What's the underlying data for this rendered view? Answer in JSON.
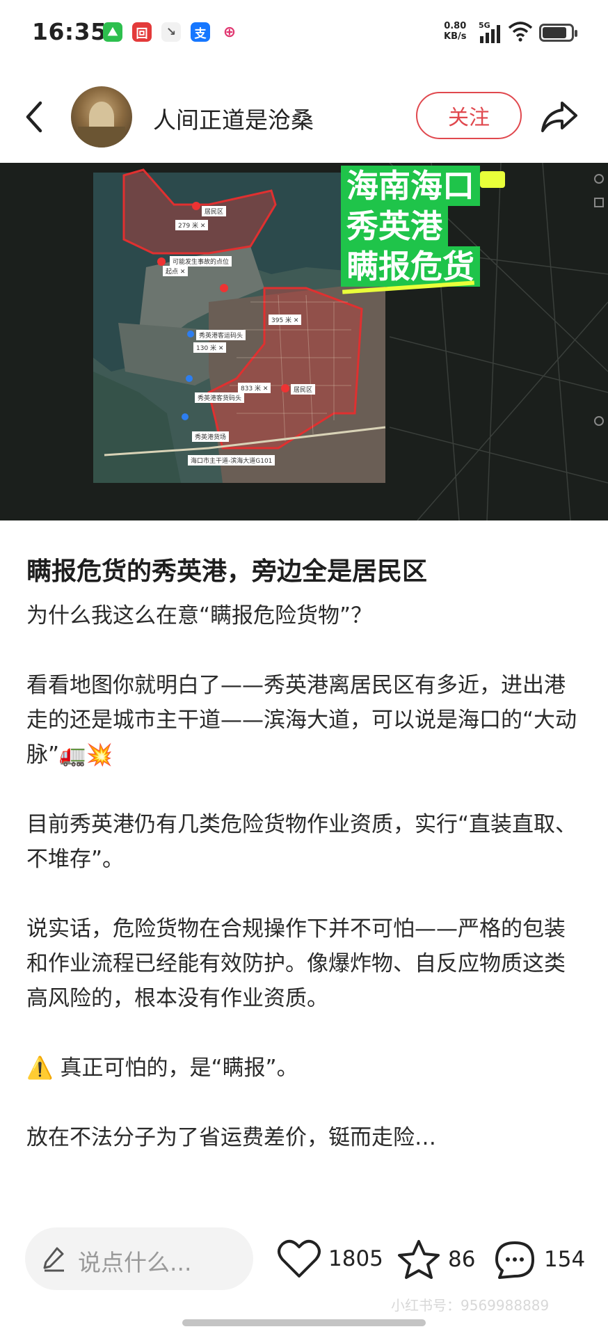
{
  "status_bar": {
    "time": "16:35",
    "net_speed_value": "0.80",
    "net_speed_unit": "KB/s",
    "network": "5G",
    "app_icons": [
      {
        "name": "app-icon-green",
        "glyph": "⛰",
        "color": "#2dbf4e"
      },
      {
        "name": "app-icon-red",
        "glyph": "回",
        "color": "#e33a3a"
      },
      {
        "name": "app-icon-gray",
        "glyph": "↘",
        "color": "#f1f1f1"
      },
      {
        "name": "alipay-icon",
        "glyph": "支",
        "color": "#1677ff"
      },
      {
        "name": "app-icon-pink",
        "glyph": "⊕",
        "color": "#e0356f"
      }
    ]
  },
  "header": {
    "username": "人间正道是沧桑",
    "follow_label": "关注"
  },
  "image": {
    "overlay_lines": [
      "海南海口",
      "秀英港",
      "瞒报危货"
    ],
    "labels": [
      {
        "text": "居民区"
      },
      {
        "text": "279 米 ✕"
      },
      {
        "text": "可能发生事故的点位"
      },
      {
        "text": "起点 ✕"
      },
      {
        "text": "395 米 ✕"
      },
      {
        "text": "秀英港客运码头"
      },
      {
        "text": "130 米 ✕"
      },
      {
        "text": "833 米 ✕"
      },
      {
        "text": "居民区"
      },
      {
        "text": "秀英港客货码头"
      },
      {
        "text": "秀英港货场"
      },
      {
        "text": "海口市主干道-滨海大道G101"
      }
    ]
  },
  "post": {
    "title": "瞒报危货的秀英港，旁边全是居民区",
    "paragraphs": [
      "为什么我这么在意“瞒报危险货物”？",
      "看看地图你就明白了——秀英港离居民区有多近，进出港走的还是城市主干道——滨海大道，可以说是海口的“大动脉”🚛💥",
      "目前秀英港仍有几类危险货物作业资质，实行“直装直取、不堆存”。",
      "说实话，危险货物在合规操作下并不可怕——严格的包装和作业流程已经能有效防护。像爆炸物、自反应物质这类高风险的，根本没有作业资质。",
      "⚠️ 真正可怕的，是“瞒报”。",
      "放在不法分子为了省运费差价，铤而走险…"
    ]
  },
  "bottom_bar": {
    "comment_placeholder": "说点什么...",
    "likes": "1805",
    "favorites": "86",
    "comments": "154",
    "watermark": "小红书号：9569988889"
  },
  "colors": {
    "accent": "#e0484e",
    "overlay_green": "#1fc44a",
    "overlay_yellow": "#e9ff3a",
    "region_outline": "#e03030"
  }
}
